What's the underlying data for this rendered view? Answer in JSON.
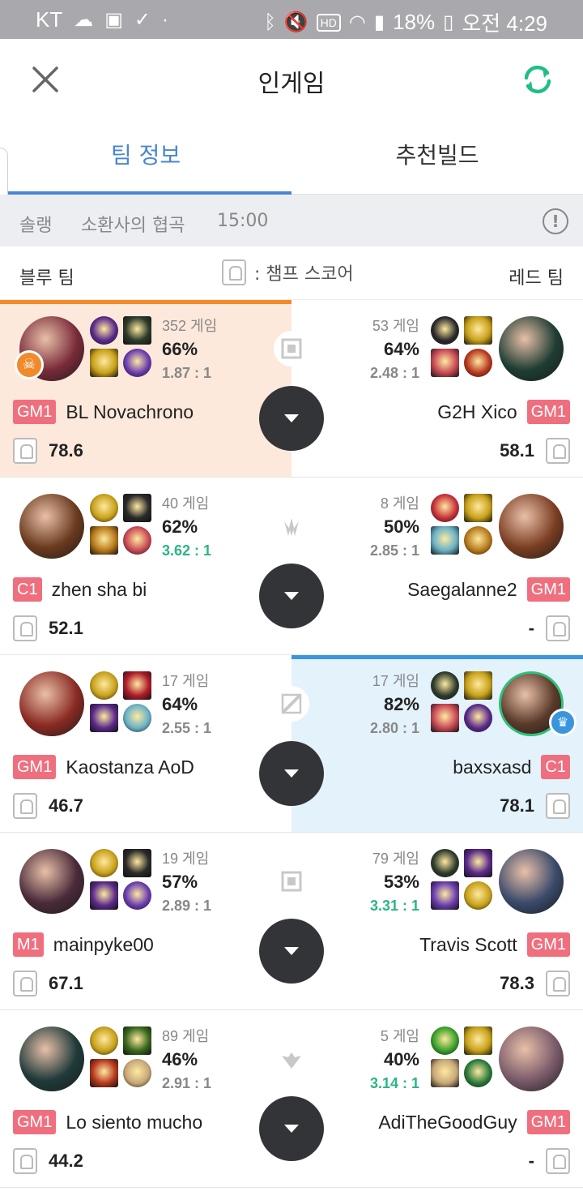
{
  "status": {
    "carrier": "KT",
    "battery": "18%",
    "time": "오전 4:29",
    "hd": "HD"
  },
  "header": {
    "title": "인게임"
  },
  "tabs": [
    "팀 정보",
    "추천빌드"
  ],
  "info": {
    "mode": "솔랭",
    "map": "소환사의 협곡",
    "time": "15:00"
  },
  "teams": {
    "blue": "블루 팀",
    "red": "레드 팀",
    "score_label": ": 챔프 스코어"
  },
  "rows": [
    {
      "lane_icon": "top-lane-icon",
      "blue": {
        "games": "352 게임",
        "winrate": "66%",
        "kda": "1.87 : 1",
        "kda_good": false,
        "tier": "GM1",
        "name": "BL Novachrono",
        "score": "78.6",
        "champ_color": "#7a2b3a",
        "icons": [
          "#5a2a8a",
          "#2e3b2c",
          "#c9a21a",
          "#6a3cb0"
        ]
      },
      "red": {
        "games": "53 게임",
        "winrate": "64%",
        "kda": "2.48 : 1",
        "kda_good": false,
        "tier": "GM1",
        "name": "G2H Xico",
        "score": "58.1",
        "champ_color": "#1e3d33",
        "icons": [
          "#2a2a2a",
          "#c9a21a",
          "#c84a55",
          "#b8381e"
        ]
      }
    },
    {
      "lane_icon": "jungle-icon",
      "blue": {
        "games": "40 게임",
        "winrate": "62%",
        "kda": "3.62 : 1",
        "kda_good": true,
        "tier": "C1",
        "name": "zhen sha bi",
        "score": "52.1",
        "champ_color": "#6a3a1e",
        "icons": [
          "#c9a21a",
          "#2a2a2a",
          "#b87a1a",
          "#c84a55"
        ]
      },
      "red": {
        "games": "8 게임",
        "winrate": "50%",
        "kda": "2.85 : 1",
        "kda_good": false,
        "tier": "GM1",
        "name": "Saegalanne2",
        "score": "-",
        "champ_color": "#7a3d22",
        "icons": [
          "#c8303a",
          "#c9a21a",
          "#6ab2c8",
          "#b87a1a"
        ]
      }
    },
    {
      "lane_icon": "mid-lane-icon",
      "blue": {
        "games": "17 게임",
        "winrate": "64%",
        "kda": "2.55 : 1",
        "kda_good": false,
        "tier": "GM1",
        "name": "Kaostanza AoD",
        "score": "46.7",
        "champ_color": "#8a2a22",
        "icons": [
          "#c9a21a",
          "#b01c2a",
          "#5a2a8a",
          "#6ab2c8"
        ]
      },
      "red": {
        "games": "17 게임",
        "winrate": "82%",
        "kda": "2.80 : 1",
        "kda_good": false,
        "tier": "C1",
        "name": "baxsxasd",
        "score": "78.1",
        "champ_color": "#5a3a2a",
        "icons": [
          "#2e3b2c",
          "#c9a21a",
          "#c84a55",
          "#5a2a8a"
        ]
      }
    },
    {
      "lane_icon": "bot-lane-icon",
      "blue": {
        "games": "19 게임",
        "winrate": "57%",
        "kda": "2.89 : 1",
        "kda_good": false,
        "tier": "M1",
        "name": "mainpyke00",
        "score": "67.1",
        "champ_color": "#4a2a3a",
        "icons": [
          "#c9a21a",
          "#2a2a2a",
          "#5a2a8a",
          "#6a3cb0"
        ]
      },
      "red": {
        "games": "79 게임",
        "winrate": "53%",
        "kda": "3.31 : 1",
        "kda_good": true,
        "tier": "GM1",
        "name": "Travis Scott",
        "score": "78.3",
        "champ_color": "#3a4a6a",
        "icons": [
          "#2e3b2c",
          "#5a2a8a",
          "#6a3cb0",
          "#c9a21a"
        ]
      }
    },
    {
      "lane_icon": "support-icon",
      "blue": {
        "games": "89 게임",
        "winrate": "46%",
        "kda": "2.91 : 1",
        "kda_good": false,
        "tier": "GM1",
        "name": "Lo siento mucho",
        "score": "44.2",
        "champ_color": "#1f3a3a",
        "icons": [
          "#c9a21a",
          "#3a6a1e",
          "#b8381e",
          "#c8a878"
        ]
      },
      "red": {
        "games": "5 게임",
        "winrate": "40%",
        "kda": "3.14 : 1",
        "kda_good": true,
        "tier": "GM1",
        "name": "AdiTheGoodGuy",
        "score": "-",
        "champ_color": "#7a5a6a",
        "icons": [
          "#3aa02a",
          "#c9a21a",
          "#c8a878",
          "#2a7a3a"
        ]
      }
    }
  ]
}
